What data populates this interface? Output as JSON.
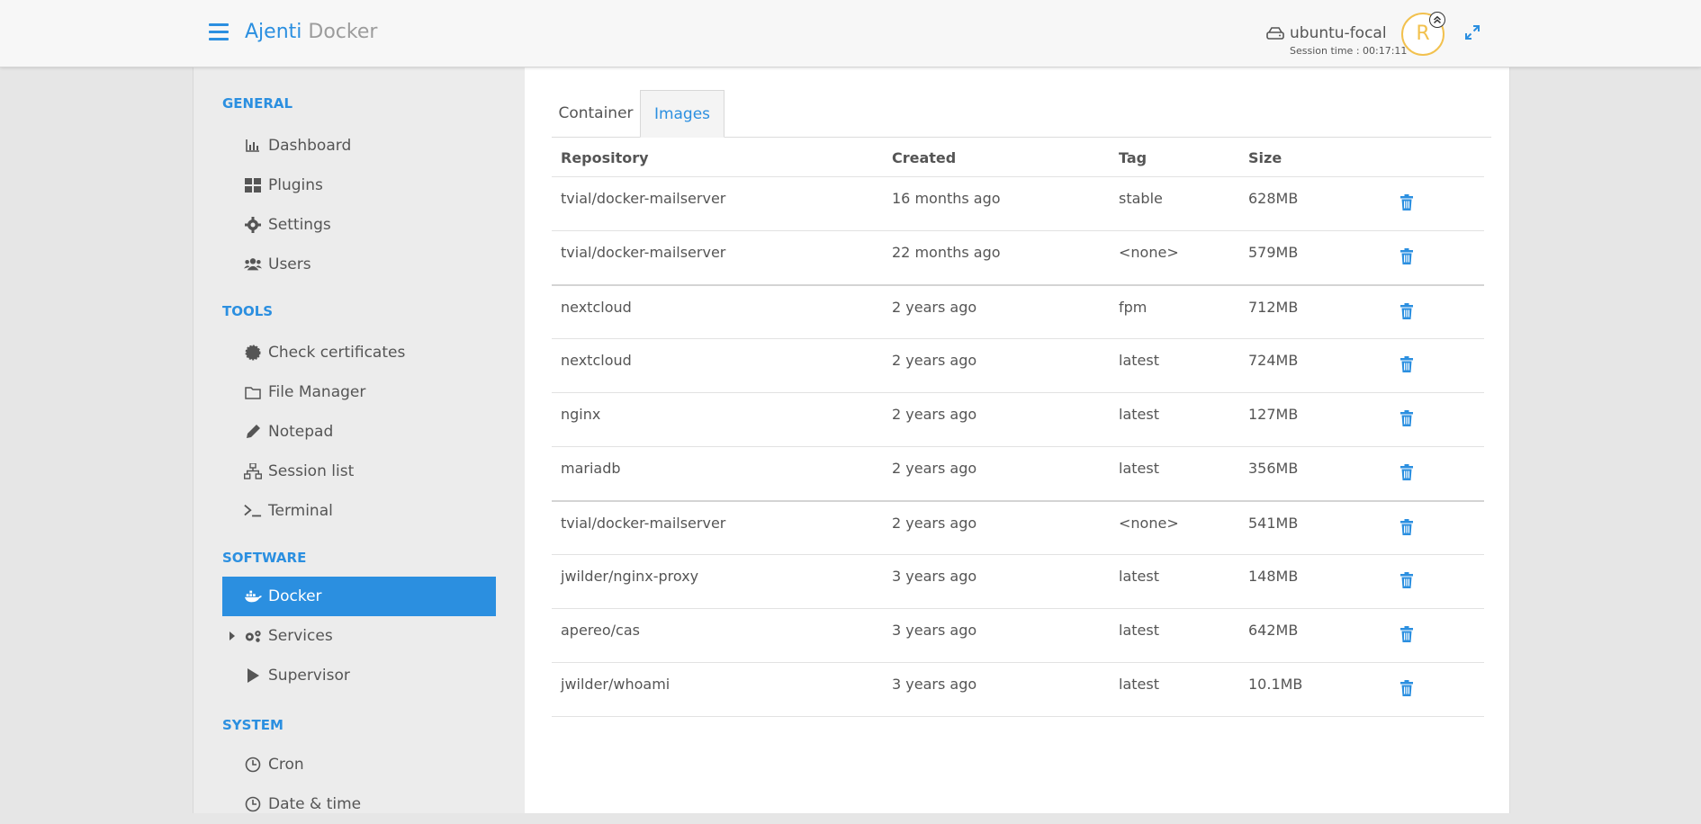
{
  "header": {
    "brand_primary": "Ajenti",
    "brand_secondary": "Docker",
    "hostname": "ubuntu-focal",
    "session_time": "Session time : 00:17:11",
    "avatar_letter": "R",
    "accent_color": "#2b8fe0"
  },
  "sidebar": {
    "sections": [
      {
        "title": "GENERAL",
        "items": [
          {
            "label": "Dashboard",
            "icon": "chart-icon"
          },
          {
            "label": "Plugins",
            "icon": "grid-icon"
          },
          {
            "label": "Settings",
            "icon": "gear-icon"
          },
          {
            "label": "Users",
            "icon": "users-icon"
          }
        ]
      },
      {
        "title": "TOOLS",
        "items": [
          {
            "label": "Check certificates",
            "icon": "certificate-icon"
          },
          {
            "label": "File Manager",
            "icon": "folder-icon"
          },
          {
            "label": "Notepad",
            "icon": "pencil-icon"
          },
          {
            "label": "Session list",
            "icon": "sitemap-icon"
          },
          {
            "label": "Terminal",
            "icon": "terminal-icon"
          }
        ]
      },
      {
        "title": "SOFTWARE",
        "items": [
          {
            "label": "Docker",
            "icon": "docker-icon",
            "active": true
          },
          {
            "label": "Services",
            "icon": "cogs-icon"
          },
          {
            "label": "Supervisor",
            "icon": "play-icon"
          }
        ]
      },
      {
        "title": "SYSTEM",
        "items": [
          {
            "label": "Cron",
            "icon": "clock-icon"
          },
          {
            "label": "Date & time",
            "icon": "clock-icon"
          }
        ]
      }
    ]
  },
  "tabs": [
    {
      "label": "Container"
    },
    {
      "label": "Images",
      "active": true
    }
  ],
  "table": {
    "headers": [
      "Repository",
      "Created",
      "Tag",
      "Size"
    ],
    "rows": [
      {
        "repository": "tvial/docker-mailserver",
        "created": "16 months ago",
        "tag": "stable",
        "size": "628MB"
      },
      {
        "repository": "tvial/docker-mailserver",
        "created": "22 months ago",
        "tag": "<none>",
        "size": "579MB"
      },
      {
        "repository": "nextcloud",
        "created": "2 years ago",
        "tag": "fpm",
        "size": "712MB"
      },
      {
        "repository": "nextcloud",
        "created": "2 years ago",
        "tag": "latest",
        "size": "724MB"
      },
      {
        "repository": "nginx",
        "created": "2 years ago",
        "tag": "latest",
        "size": "127MB"
      },
      {
        "repository": "mariadb",
        "created": "2 years ago",
        "tag": "latest",
        "size": "356MB"
      },
      {
        "repository": "tvial/docker-mailserver",
        "created": "2 years ago",
        "tag": "<none>",
        "size": "541MB"
      },
      {
        "repository": "jwilder/nginx-proxy",
        "created": "3 years ago",
        "tag": "latest",
        "size": "148MB"
      },
      {
        "repository": "apereo/cas",
        "created": "3 years ago",
        "tag": "latest",
        "size": "642MB"
      },
      {
        "repository": "jwilder/whoami",
        "created": "3 years ago",
        "tag": "latest",
        "size": "10.1MB"
      }
    ]
  }
}
